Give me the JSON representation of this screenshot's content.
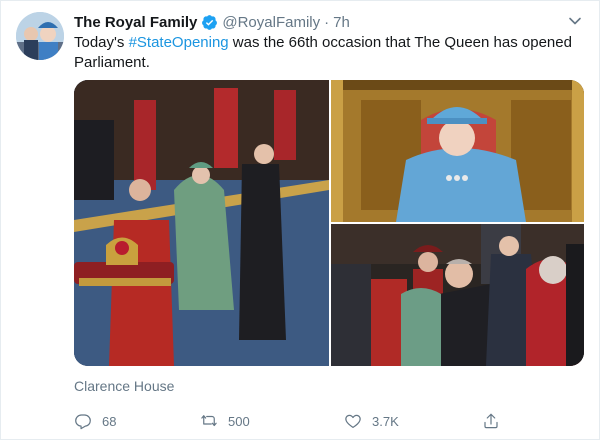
{
  "tweet": {
    "display_name": "The Royal Family",
    "handle": "@RoyalFamily",
    "separator": "·",
    "time": "7h",
    "text_before": "Today's ",
    "hashtag": "#StateOpening",
    "text_after": " was the 66th occasion that The Queen has opened Parliament.",
    "credit": "Clarence House"
  },
  "actions": {
    "reply_count": "68",
    "retweet_count": "500",
    "like_count": "3.7K"
  },
  "icons": {
    "verified": "verified-badge-icon",
    "more": "chevron-down-icon",
    "reply": "reply-icon",
    "retweet": "retweet-icon",
    "like": "heart-icon",
    "share": "share-icon"
  },
  "colors": {
    "link": "#1b95e0",
    "muted": "#657786",
    "text": "#14171a"
  }
}
